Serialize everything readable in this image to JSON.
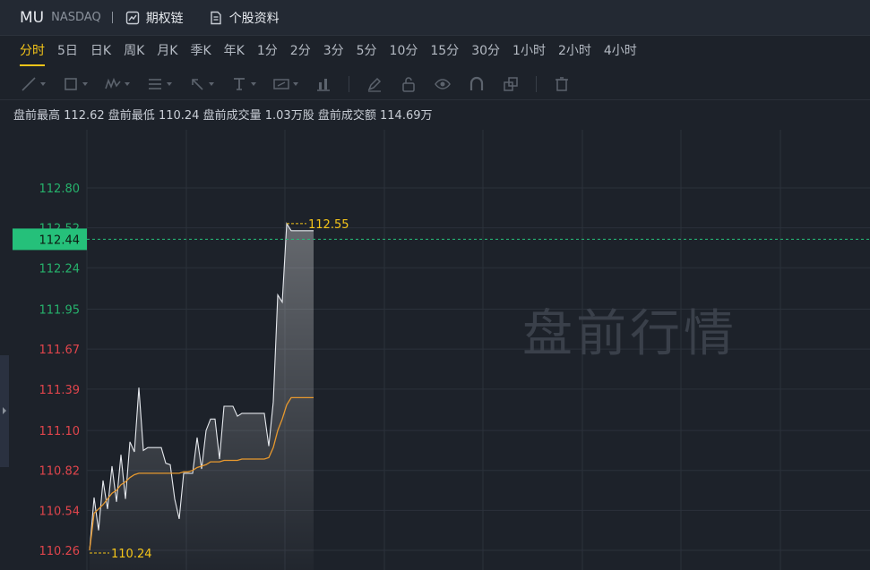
{
  "header": {
    "symbol": "MU",
    "exchange": "NASDAQ",
    "links": [
      {
        "label": "期权链",
        "icon": "chart-doc-icon"
      },
      {
        "label": "个股资料",
        "icon": "document-icon"
      }
    ]
  },
  "timeframes": [
    {
      "label": "分时",
      "active": true
    },
    {
      "label": "5日"
    },
    {
      "label": "日K"
    },
    {
      "label": "周K"
    },
    {
      "label": "月K"
    },
    {
      "label": "季K"
    },
    {
      "label": "年K"
    },
    {
      "label": "1分"
    },
    {
      "label": "2分"
    },
    {
      "label": "3分"
    },
    {
      "label": "5分"
    },
    {
      "label": "10分"
    },
    {
      "label": "15分"
    },
    {
      "label": "30分"
    },
    {
      "label": "1小时"
    },
    {
      "label": "2小时"
    },
    {
      "label": "4小时"
    }
  ],
  "toolbar_icons": [
    "trend-line-icon",
    "rectangle-icon",
    "wave-icon",
    "fibonacci-icon",
    "arrow-icon",
    "text-icon",
    "measure-icon",
    "bar-marker-icon",
    "pen-icon",
    "lock-icon",
    "eye-icon",
    "magnet-icon",
    "copy-icon",
    "trash-icon"
  ],
  "info": {
    "high_label": "盘前最高",
    "high": "112.62",
    "low_label": "盘前最低",
    "low": "110.24",
    "vol_label": "盘前成交量",
    "vol": "1.03万股",
    "amt_label": "盘前成交额",
    "amt": "114.69万"
  },
  "colors": {
    "up": "#26b26c",
    "down": "#e0454c",
    "accent": "#f5c519",
    "price_line": "#e6e9ee",
    "avg_line": "#e8992e",
    "current_tag": "#25c07a"
  },
  "chart_data": {
    "type": "line",
    "watermark": "盘前行情",
    "ylim": [
      110.2,
      113.05
    ],
    "y_ticks": [
      "112.80",
      "112.52",
      "112.24",
      "111.95",
      "111.67",
      "111.39",
      "111.10",
      "110.82",
      "110.54",
      "110.26"
    ],
    "current_price": "112.44",
    "high_marker": "112.55",
    "low_marker": "110.24",
    "x": [
      0,
      1,
      2,
      3,
      4,
      5,
      6,
      7,
      8,
      9,
      10,
      11,
      12,
      13,
      14,
      15,
      16,
      17,
      18,
      19,
      20,
      21,
      22,
      23,
      24,
      25,
      26,
      27,
      28,
      29,
      30,
      31,
      32,
      33,
      34,
      35,
      36,
      37,
      38,
      39,
      40,
      41,
      42,
      43,
      44,
      45,
      46,
      47,
      48,
      49,
      50
    ],
    "series": [
      {
        "name": "price",
        "values": [
          110.26,
          110.63,
          110.4,
          110.75,
          110.55,
          110.85,
          110.6,
          110.93,
          110.62,
          111.02,
          110.95,
          111.4,
          110.96,
          110.98,
          110.98,
          110.98,
          110.98,
          110.87,
          110.86,
          110.62,
          110.48,
          110.8,
          110.8,
          110.8,
          111.05,
          110.83,
          111.1,
          111.18,
          111.18,
          110.9,
          111.27,
          111.27,
          111.27,
          111.2,
          111.22,
          111.22,
          111.22,
          111.22,
          111.22,
          111.22,
          110.99,
          111.3,
          112.05,
          112.0,
          112.55,
          112.5,
          112.5,
          112.5,
          112.5,
          112.5,
          112.5
        ]
      },
      {
        "name": "avg",
        "values": [
          110.26,
          110.52,
          110.55,
          110.58,
          110.62,
          110.66,
          110.68,
          110.72,
          110.74,
          110.77,
          110.79,
          110.8,
          110.8,
          110.8,
          110.8,
          110.8,
          110.8,
          110.8,
          110.8,
          110.8,
          110.8,
          110.81,
          110.81,
          110.82,
          110.84,
          110.85,
          110.86,
          110.88,
          110.88,
          110.88,
          110.89,
          110.89,
          110.89,
          110.89,
          110.9,
          110.9,
          110.9,
          110.9,
          110.9,
          110.9,
          110.91,
          110.98,
          111.1,
          111.18,
          111.28,
          111.33,
          111.33,
          111.33,
          111.33,
          111.33,
          111.33
        ]
      }
    ]
  }
}
